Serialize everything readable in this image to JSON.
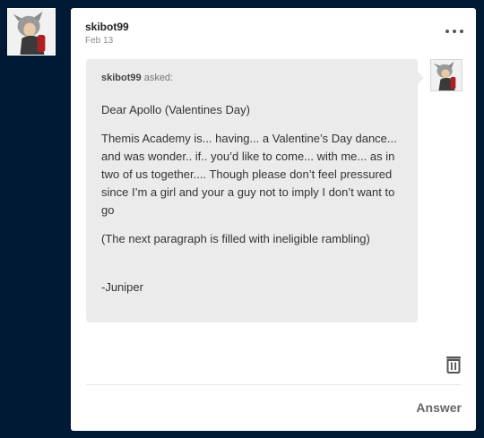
{
  "post": {
    "username": "skibot99",
    "date": "Feb 13"
  },
  "ask": {
    "asker": "skibot99",
    "asked_suffix": " asked:",
    "paragraphs": [
      "Dear Apollo (Valentines Day)",
      "Themis Academy is... having... a Valentine’s Day dance... and was wonder.. if.. you’d like to come... with me... as in two of us together.... Though please don’t feel pressured since I’m a girl and your a guy not to imply I don’t want to go",
      "(The next paragraph is filled with ineligible rambling)",
      "-Juniper"
    ]
  },
  "actions": {
    "answer_label": "Answer",
    "more_icon": "more-horizontal-icon",
    "delete_icon": "trash-icon"
  },
  "colors": {
    "background": "#001935",
    "card": "#ffffff",
    "ask_bubble": "#ebebeb"
  }
}
